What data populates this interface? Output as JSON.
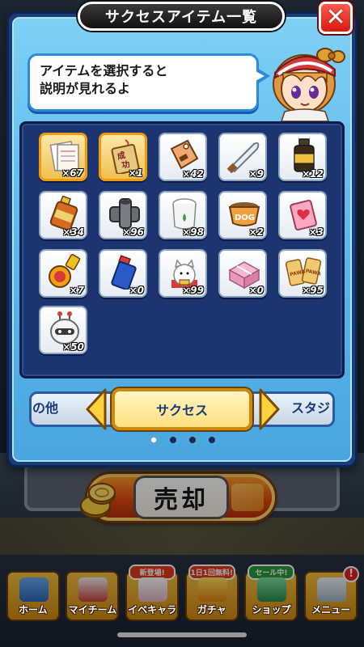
{
  "modal": {
    "title": "サクセスアイテム一覧",
    "close_label": "✕",
    "bubble_lines": [
      "アイテムを選択すると",
      "説明が見れるよ"
    ]
  },
  "items": [
    {
      "icon": "document-icon",
      "count": "×67",
      "selected": true
    },
    {
      "icon": "omamori-charm-icon",
      "count": "×1",
      "selected": true
    },
    {
      "icon": "tag-icon",
      "count": "×42",
      "selected": false
    },
    {
      "icon": "knife-icon",
      "count": "×9",
      "selected": false
    },
    {
      "icon": "bottle-icon",
      "count": "×12",
      "selected": false
    },
    {
      "icon": "drink-bottle-icon",
      "count": "×34",
      "selected": false
    },
    {
      "icon": "pipe-joint-icon",
      "count": "×96",
      "selected": false
    },
    {
      "icon": "aroma-pot-icon",
      "count": "×98",
      "selected": false
    },
    {
      "icon": "dog-food-bowl-icon",
      "count": "×2",
      "selected": false
    },
    {
      "icon": "heart-tag-icon",
      "count": "×3",
      "selected": false
    },
    {
      "icon": "trophy-ball-icon",
      "count": "×7",
      "selected": false
    },
    {
      "icon": "spray-can-icon",
      "count": "×0",
      "selected": false
    },
    {
      "icon": "lucky-cat-icon",
      "count": "×99",
      "selected": false
    },
    {
      "icon": "gift-box-icon",
      "count": "×0",
      "selected": false
    },
    {
      "icon": "pawa-ticket-icon",
      "count": "×95",
      "selected": false
    },
    {
      "icon": "robot-icon",
      "count": "×50",
      "selected": false
    }
  ],
  "categories": {
    "left": "の他",
    "center": "サクセス",
    "right": "スタジ"
  },
  "page_dots": {
    "total": 4,
    "active": 0
  },
  "sell_button": {
    "label": "売却"
  },
  "nav": [
    {
      "label": "ホーム",
      "badge": "",
      "alert": false
    },
    {
      "label": "マイチーム",
      "badge": "",
      "alert": false
    },
    {
      "label": "イベキャラ",
      "badge": "新登場!",
      "alert": false
    },
    {
      "label": "ガチャ",
      "badge": "1日1回無料!",
      "alert": false
    },
    {
      "label": "ショップ",
      "badge": "セール中!",
      "alert": false
    },
    {
      "label": "メニュー",
      "badge": "",
      "alert": true
    }
  ],
  "colors": {
    "modal_frame": "#1a3c78",
    "modal_body": "#5ab8ec",
    "selected_item": "#f0c050",
    "close_red": "#d81a10"
  }
}
